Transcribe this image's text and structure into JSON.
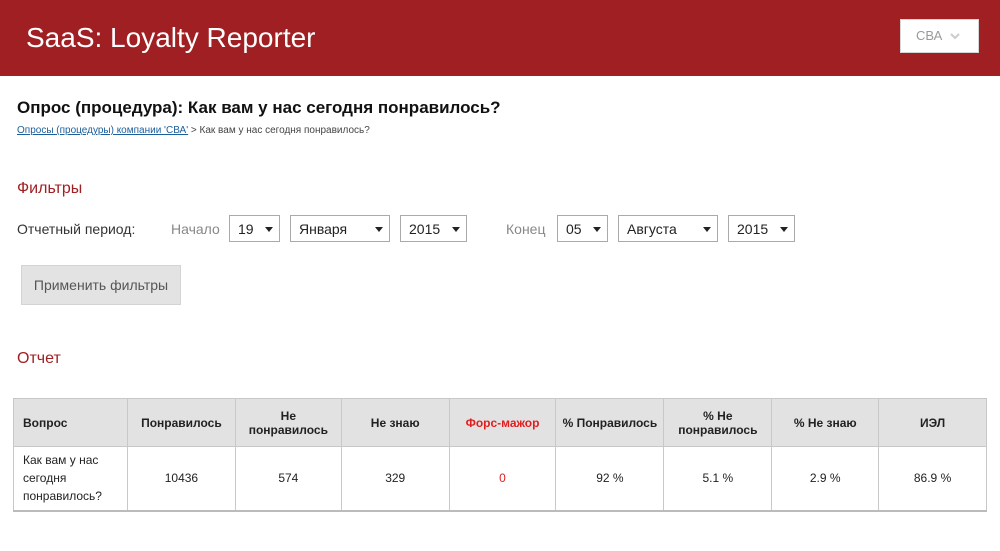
{
  "header": {
    "app_title": "SaaS: Loyalty Reporter",
    "company_select": "СВА",
    "bg_color": "#a01f23"
  },
  "page": {
    "title": "Опрос (процедура): Как вам у нас сегодня понравилось?",
    "breadcrumb_link": "Опросы (процедуры) компании 'СВА'",
    "breadcrumb_sep": " > ",
    "breadcrumb_current": "Как вам у нас сегодня понравилось?"
  },
  "filters": {
    "title": "Фильтры",
    "period_label": "Отчетный период:",
    "start_label": "Начало",
    "start_day": "19",
    "start_month": "Января",
    "start_year": "2015",
    "end_label": "Конец",
    "end_day": "05",
    "end_month": "Августа",
    "end_year": "2015",
    "apply_label": "Применить фильтры"
  },
  "report": {
    "title": "Отчет",
    "columns": [
      "Вопрос",
      "Понравилось",
      "Не понравилось",
      "Не знаю",
      "Форс-мажор",
      "% Понравилось",
      "% Не понравилось",
      "% Не знаю",
      "ИЭЛ"
    ],
    "rows": [
      [
        "Как вам у нас сегодня понравилось?",
        "10436",
        "574",
        "329",
        "0",
        "92 %",
        "5.1 %",
        "2.9 %",
        "86.9 %"
      ]
    ]
  }
}
